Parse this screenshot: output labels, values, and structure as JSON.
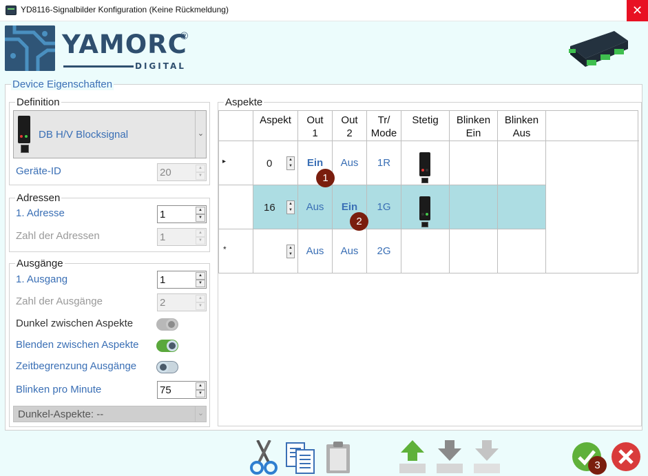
{
  "window": {
    "title": "YD8116-Signalbilder Konfiguration (Keine Rückmeldung)",
    "close_glyph": "✕"
  },
  "logo": {
    "brand": "YAMORC",
    "registered": "®",
    "sub": "DIGITAL"
  },
  "device_props": {
    "legend": "Device Eigenschaften",
    "definition": {
      "legend": "Definition",
      "selected": "DB H/V Blocksignal",
      "geraete_id_label": "Geräte-ID",
      "geraete_id_value": "20"
    },
    "adressen": {
      "legend": "Adressen",
      "adresse_label": "1. Adresse",
      "adresse_value": "1",
      "zahl_label": "Zahl der Adressen",
      "zahl_value": "1"
    },
    "ausgaenge": {
      "legend": "Ausgänge",
      "ausgang_label": "1. Ausgang",
      "ausgang_value": "1",
      "zahl_label": "Zahl der Ausgänge",
      "zahl_value": "2",
      "dunkel_label": "Dunkel zwischen Aspekte",
      "dunkel_state": "off (disabled)",
      "blenden_label": "Blenden zwischen Aspekte",
      "blenden_state": "on",
      "zeit_label": "Zeitbegrenzung Ausgänge",
      "zeit_state": "off",
      "blinken_label": "Blinken pro Minute",
      "blinken_value": "75",
      "dunkel_combo": "Dunkel-Aspekte: --"
    }
  },
  "aspekte": {
    "legend": "Aspekte",
    "headers": {
      "aspekt": "Aspekt",
      "out1_a": "Out",
      "out1_b": "1",
      "out2_a": "Out",
      "out2_b": "2",
      "mode_a": "Tr/",
      "mode_b": "Mode",
      "stetig": "Stetig",
      "blinken_ein_a": "Blinken",
      "blinken_ein_b": "Ein",
      "blinken_aus_a": "Blinken",
      "blinken_aus_b": "Aus"
    },
    "rows": [
      {
        "marker": "▸",
        "aspekt": "0",
        "out1": "Ein",
        "out2": "Aus",
        "mode": "1R",
        "signal": "red"
      },
      {
        "marker": "",
        "aspekt": "16",
        "out1": "Aus",
        "out2": "Ein",
        "mode": "1G",
        "signal": "green"
      },
      {
        "marker": "*",
        "aspekt": "",
        "out1": "Aus",
        "out2": "Aus",
        "mode": "2G",
        "signal": ""
      }
    ]
  },
  "badges": [
    "1",
    "2",
    "3"
  ],
  "toolbar": {
    "icons": [
      "scissors-icon",
      "copy-icon",
      "paste-icon",
      "move-up-icon",
      "move-down-icon",
      "move-down-disabled-icon",
      "ok-icon",
      "cancel-icon"
    ]
  },
  "colors": {
    "accent_blue": "#3a6fb5",
    "selection": "#addde3",
    "background": "#ecfcfc",
    "badge": "#7a1e0e",
    "ok_green": "#5fb13a",
    "cancel_red": "#d93b3b"
  }
}
